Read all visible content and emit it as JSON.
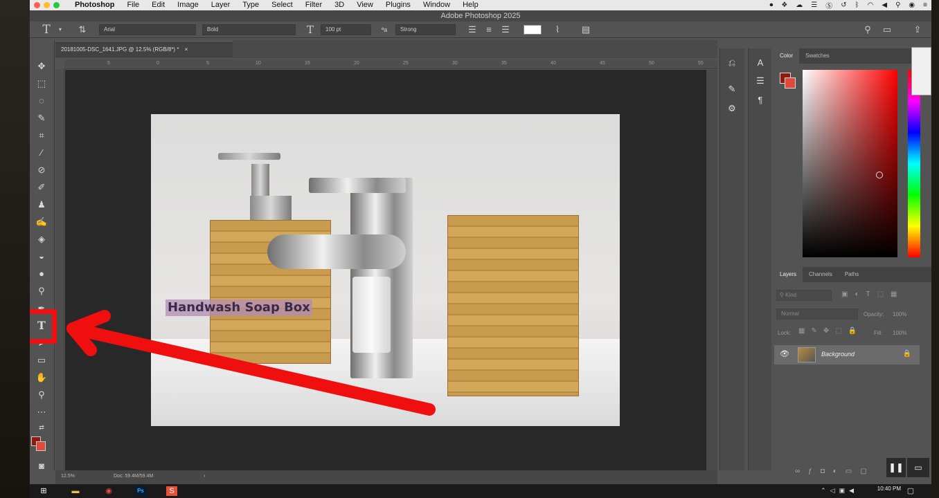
{
  "menubar": {
    "app_name": "Photoshop",
    "items": [
      "File",
      "Edit",
      "Image",
      "Layer",
      "Type",
      "Select",
      "Filter",
      "3D",
      "View",
      "Plugins",
      "Window",
      "Help"
    ]
  },
  "window_title": "Adobe Photoshop 2025",
  "options_bar": {
    "font_family": "Arial",
    "font_style": "Bold",
    "font_size": "100 pt",
    "anti_alias": "Strong",
    "text_color": "#ffffff"
  },
  "document_tab": "20181005-DSC_1641.JPG @ 12.5% (RGB/8*) *",
  "ruler_marks": [
    "5",
    "0",
    "5",
    "10",
    "15",
    "20",
    "25",
    "30",
    "35",
    "40",
    "45",
    "50",
    "55"
  ],
  "canvas": {
    "text_layer": "Handwash Soap Box",
    "text_layer_color": "#b28cb4"
  },
  "status_bar": {
    "zoom": "12.5%",
    "doc_size": "Doc: 59.4M/59.4M"
  },
  "annotation": {
    "color": "#f00f0f",
    "points_to": "type-tool"
  },
  "color_panel": {
    "tabs": [
      "Color",
      "Swatches"
    ],
    "foreground": "#8f1a12",
    "background": "#e14a3a"
  },
  "layers_panel": {
    "tabs": [
      "Layers",
      "Channels",
      "Paths"
    ],
    "kind_placeholder": "Kind",
    "blend_mode": "Normal",
    "opacity_label": "Opacity:",
    "opacity_value": "100%",
    "lock_label": "Lock:",
    "fill_label": "Fill:",
    "fill_value": "100%",
    "layers": [
      {
        "name": "Background",
        "locked": true,
        "visible": true
      }
    ]
  },
  "taskbar": {
    "time": "10:40 PM"
  }
}
